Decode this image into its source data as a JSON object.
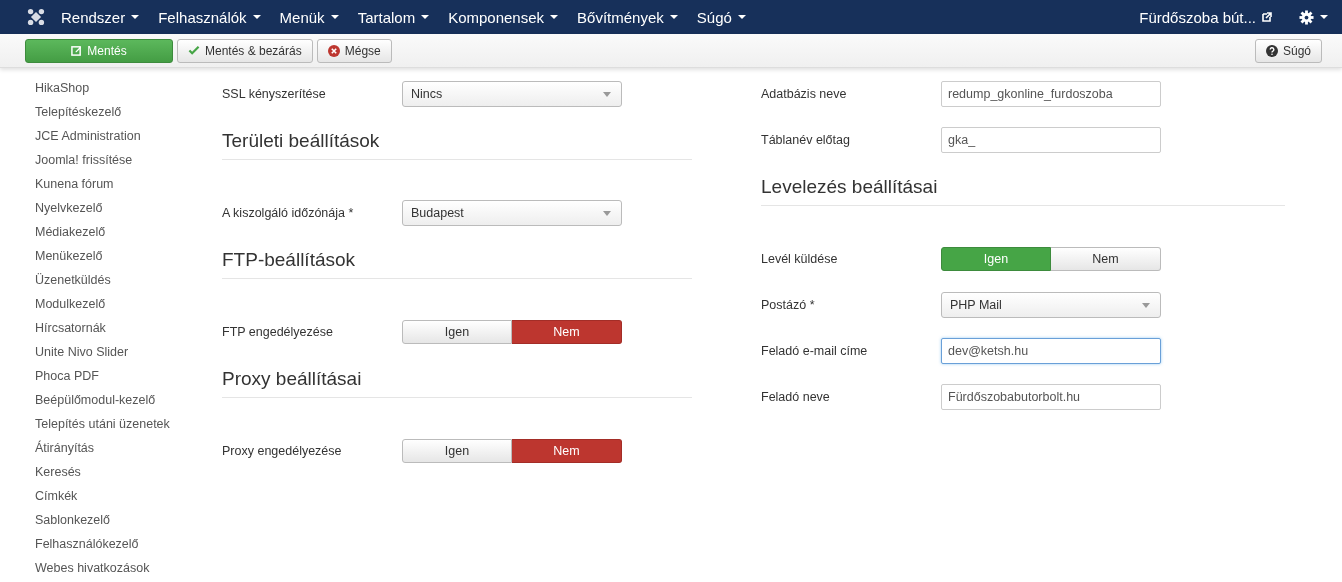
{
  "navbar": {
    "menus": [
      "Rendszer",
      "Felhasználók",
      "Menük",
      "Tartalom",
      "Komponensek",
      "Bővítmények",
      "Súgó"
    ],
    "site_link": "Fürdőszoba bút..."
  },
  "toolbar": {
    "buttons": [
      {
        "label": "Mentés",
        "kind": "save"
      },
      {
        "label": "Mentés & bezárás",
        "kind": "save-close"
      },
      {
        "label": "Mégse",
        "kind": "cancel"
      }
    ],
    "help_button": "Súgó"
  },
  "sidebar": {
    "items": [
      "HikaShop",
      "Telepítéskezelő",
      "JCE Administration",
      "Joomla! frissítése",
      "Kunena fórum",
      "Nyelvkezelő",
      "Médiakezelő",
      "Menükezelő",
      "Üzenetküldés",
      "Modulkezelő",
      "Hírcsatornák",
      "Unite Nivo Slider",
      "Phoca PDF",
      "Beépülőmodul-kezelő",
      "Telepítés utáni üzenetek",
      "Átirányítás",
      "Keresés",
      "Címkék",
      "Sablonkezelő",
      "Felhasználókezelő",
      "Webes hivatkozások"
    ]
  },
  "columns": [
    {
      "items": [
        {
          "kind": "select",
          "label": "SSL kényszerítése",
          "value": "Nincs"
        },
        {
          "kind": "heading",
          "label": "Területi beállítások"
        },
        {
          "kind": "select",
          "label": "A kiszolgáló időzónája *",
          "value": "Budapest"
        },
        {
          "kind": "heading",
          "label": "FTP-beállítások"
        },
        {
          "kind": "toggle",
          "label": "FTP engedélyezése",
          "options": [
            {
              "label": "Igen",
              "selected": false
            },
            {
              "label": "Nem",
              "selected": true
            }
          ]
        },
        {
          "kind": "heading",
          "label": "Proxy beállításai"
        },
        {
          "kind": "toggle",
          "label": "Proxy engedélyezése",
          "options": [
            {
              "label": "Igen",
              "selected": false
            },
            {
              "label": "Nem",
              "selected": true
            }
          ]
        }
      ]
    },
    {
      "items": [
        {
          "kind": "text",
          "label": "Adatbázis neve",
          "value": "redump_gkonline_furdoszoba",
          "focused": false
        },
        {
          "kind": "text",
          "label": "Táblanév előtag",
          "value": "gka_",
          "focused": false
        },
        {
          "kind": "heading",
          "label": "Levelezés beállításai"
        },
        {
          "kind": "toggle",
          "label": "Levél küldése",
          "options": [
            {
              "label": "Igen",
              "selected": true
            },
            {
              "label": "Nem",
              "selected": false
            }
          ]
        },
        {
          "kind": "select",
          "label": "Postázó *",
          "value": "PHP Mail"
        },
        {
          "kind": "text",
          "label": "Feladó e-mail címe",
          "value": "dev@ketsh.hu",
          "focused": true
        },
        {
          "kind": "text",
          "label": "Feladó neve",
          "value": "Fürdőszobabutorbolt.hu",
          "focused": false
        }
      ]
    }
  ]
}
